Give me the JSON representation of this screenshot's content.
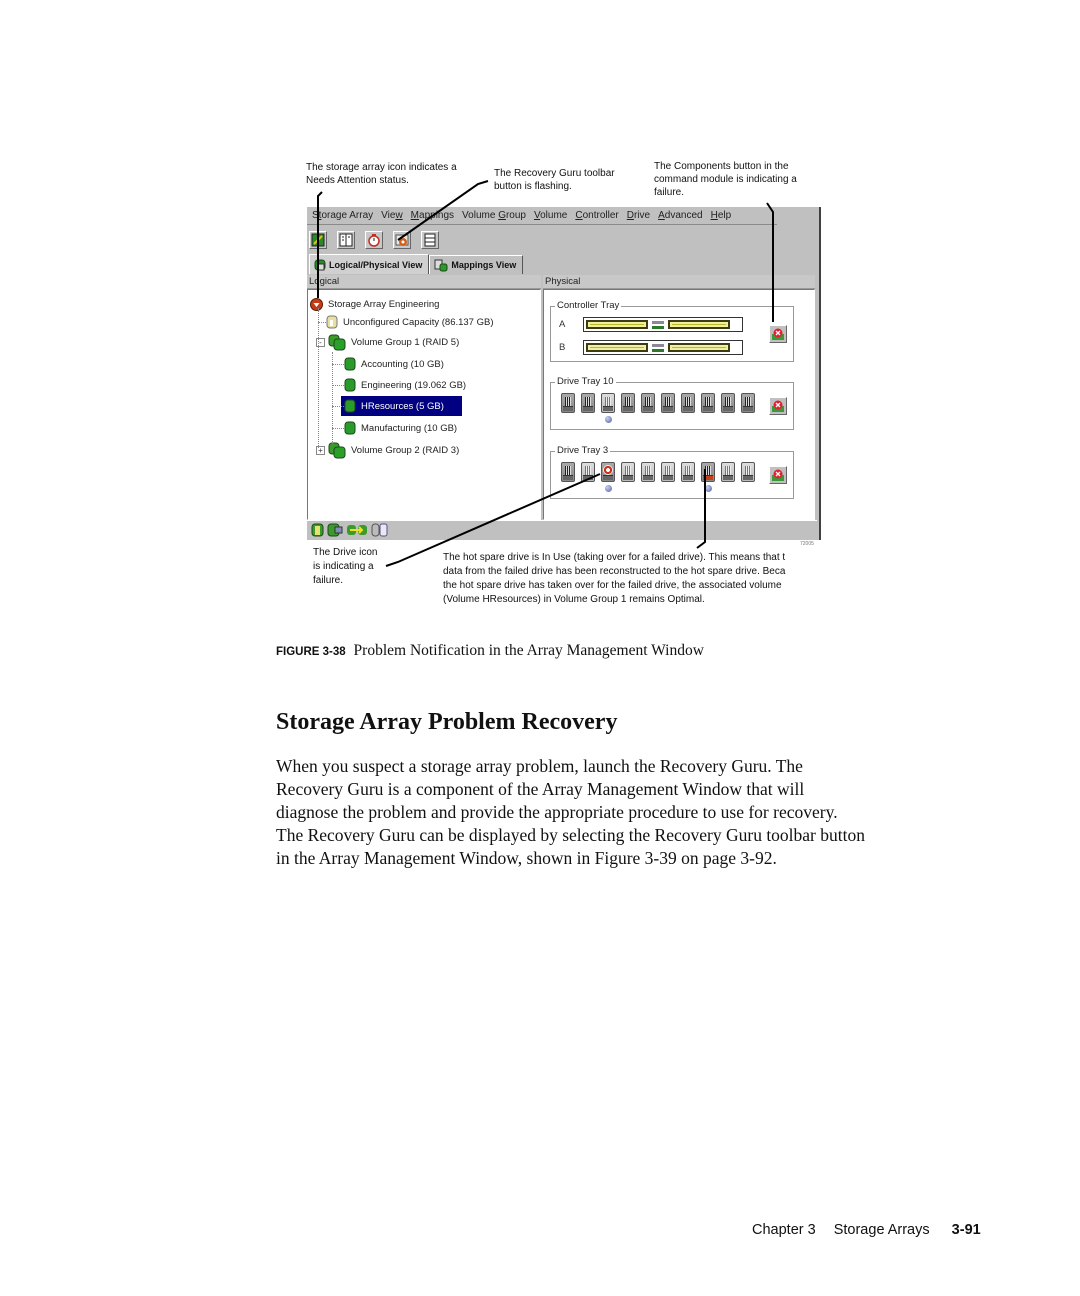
{
  "callouts": {
    "array_icon": [
      "The storage array icon indicates a",
      "Needs Attention status."
    ],
    "recovery_guru": [
      "The Recovery Guru toolbar",
      "button is flashing."
    ],
    "components": [
      "The Components button in the",
      "command module is indicating a",
      "failure."
    ],
    "drive_icon": [
      "The Drive icon",
      "is indicating a",
      "failure."
    ],
    "hot_spare": [
      "The hot spare drive is In Use (taking over for a failed drive). This means that t",
      "data from the failed drive has been reconstructed to the hot spare drive. Beca",
      "the hot spare drive has taken over for the failed drive, the associated volume",
      "(Volume HResources) in Volume Group 1 remains Optimal."
    ]
  },
  "app": {
    "menu": [
      {
        "pre": "S",
        "mn": "t",
        "post": "orage Array"
      },
      {
        "pre": "Vie",
        "mn": "w",
        "post": ""
      },
      {
        "pre": "",
        "mn": "M",
        "post": "appings"
      },
      {
        "pre": "Volume ",
        "mn": "G",
        "post": "roup"
      },
      {
        "pre": "",
        "mn": "V",
        "post": "olume"
      },
      {
        "pre": "",
        "mn": "C",
        "post": "ontroller"
      },
      {
        "pre": "",
        "mn": "D",
        "post": "rive"
      },
      {
        "pre": "",
        "mn": "A",
        "post": "dvanced"
      },
      {
        "pre": "",
        "mn": "H",
        "post": "elp"
      }
    ],
    "toolbar": [
      {
        "icon": "create-volume-icon"
      },
      {
        "icon": "view-toggle-icon"
      },
      {
        "icon": "monitor-performance-icon"
      },
      {
        "icon": "recovery-guru-icon"
      },
      {
        "icon": "components-icon"
      }
    ],
    "tabs": [
      {
        "label": "Logical/Physical View",
        "active": true
      },
      {
        "label": "Mappings View",
        "active": false
      }
    ],
    "logical_header": "Logical",
    "physical_header": "Physical",
    "tree": [
      {
        "label": "Storage Array Engineering",
        "icon": "storage-array-attention",
        "level": 0
      },
      {
        "label": "Unconfigured Capacity (86.137 GB)",
        "icon": "unconfigured-capacity",
        "level": 1
      },
      {
        "label": "Volume Group 1  (RAID 5)",
        "icon": "volume-group",
        "level": 1,
        "expander": "-"
      },
      {
        "label": "Accounting (10 GB)",
        "icon": "volume",
        "level": 2
      },
      {
        "label": "Engineering (19.062 GB)",
        "icon": "volume",
        "level": 2
      },
      {
        "label": "HResources (5 GB)",
        "icon": "volume",
        "level": 2,
        "selected": true
      },
      {
        "label": "Manufacturing (10 GB)",
        "icon": "volume",
        "level": 2
      },
      {
        "label": "Volume Group 2 (RAID 3)",
        "icon": "volume-group",
        "level": 1,
        "expander": "+"
      }
    ],
    "controller_tray": {
      "title": "Controller Tray",
      "controllers": [
        "A",
        "B"
      ]
    },
    "drive_trays": [
      {
        "title": "Drive Tray 10",
        "drives": [
          "normal",
          "normal",
          "light",
          "normal",
          "normal",
          "normal",
          "normal",
          "normal",
          "normal",
          "normal"
        ],
        "hot_spare_positions": [
          3
        ]
      },
      {
        "title": "Drive Tray 3",
        "drives": [
          "normal",
          "light",
          "failed",
          "light",
          "light",
          "light",
          "light",
          "inuse",
          "light",
          "light"
        ],
        "hot_spare_positions": [
          3,
          8
        ]
      }
    ],
    "statusbar_icons": [
      "drive-status-icon",
      "controller-status-icon",
      "volume-transfer-icon",
      "unassigned-drive-icon"
    ],
    "figure_id": "72005"
  },
  "caption": {
    "label": "FIGURE 3-38",
    "text": "Problem Notification in the Array Management Window"
  },
  "heading": "Storage Array Problem Recovery",
  "body_lines": [
    "When you suspect a storage array problem, launch the Recovery Guru. The",
    "Recovery Guru is a component of the Array Management Window that will",
    "diagnose the problem and provide the appropriate procedure to use for recovery.",
    "The Recovery Guru can be displayed by selecting the Recovery Guru toolbar button",
    "in the Array Management Window, shown in Figure 3-39 on page 3-92."
  ],
  "footer": {
    "chapter": "Chapter 3",
    "title": "Storage Arrays",
    "page": "3-91"
  }
}
